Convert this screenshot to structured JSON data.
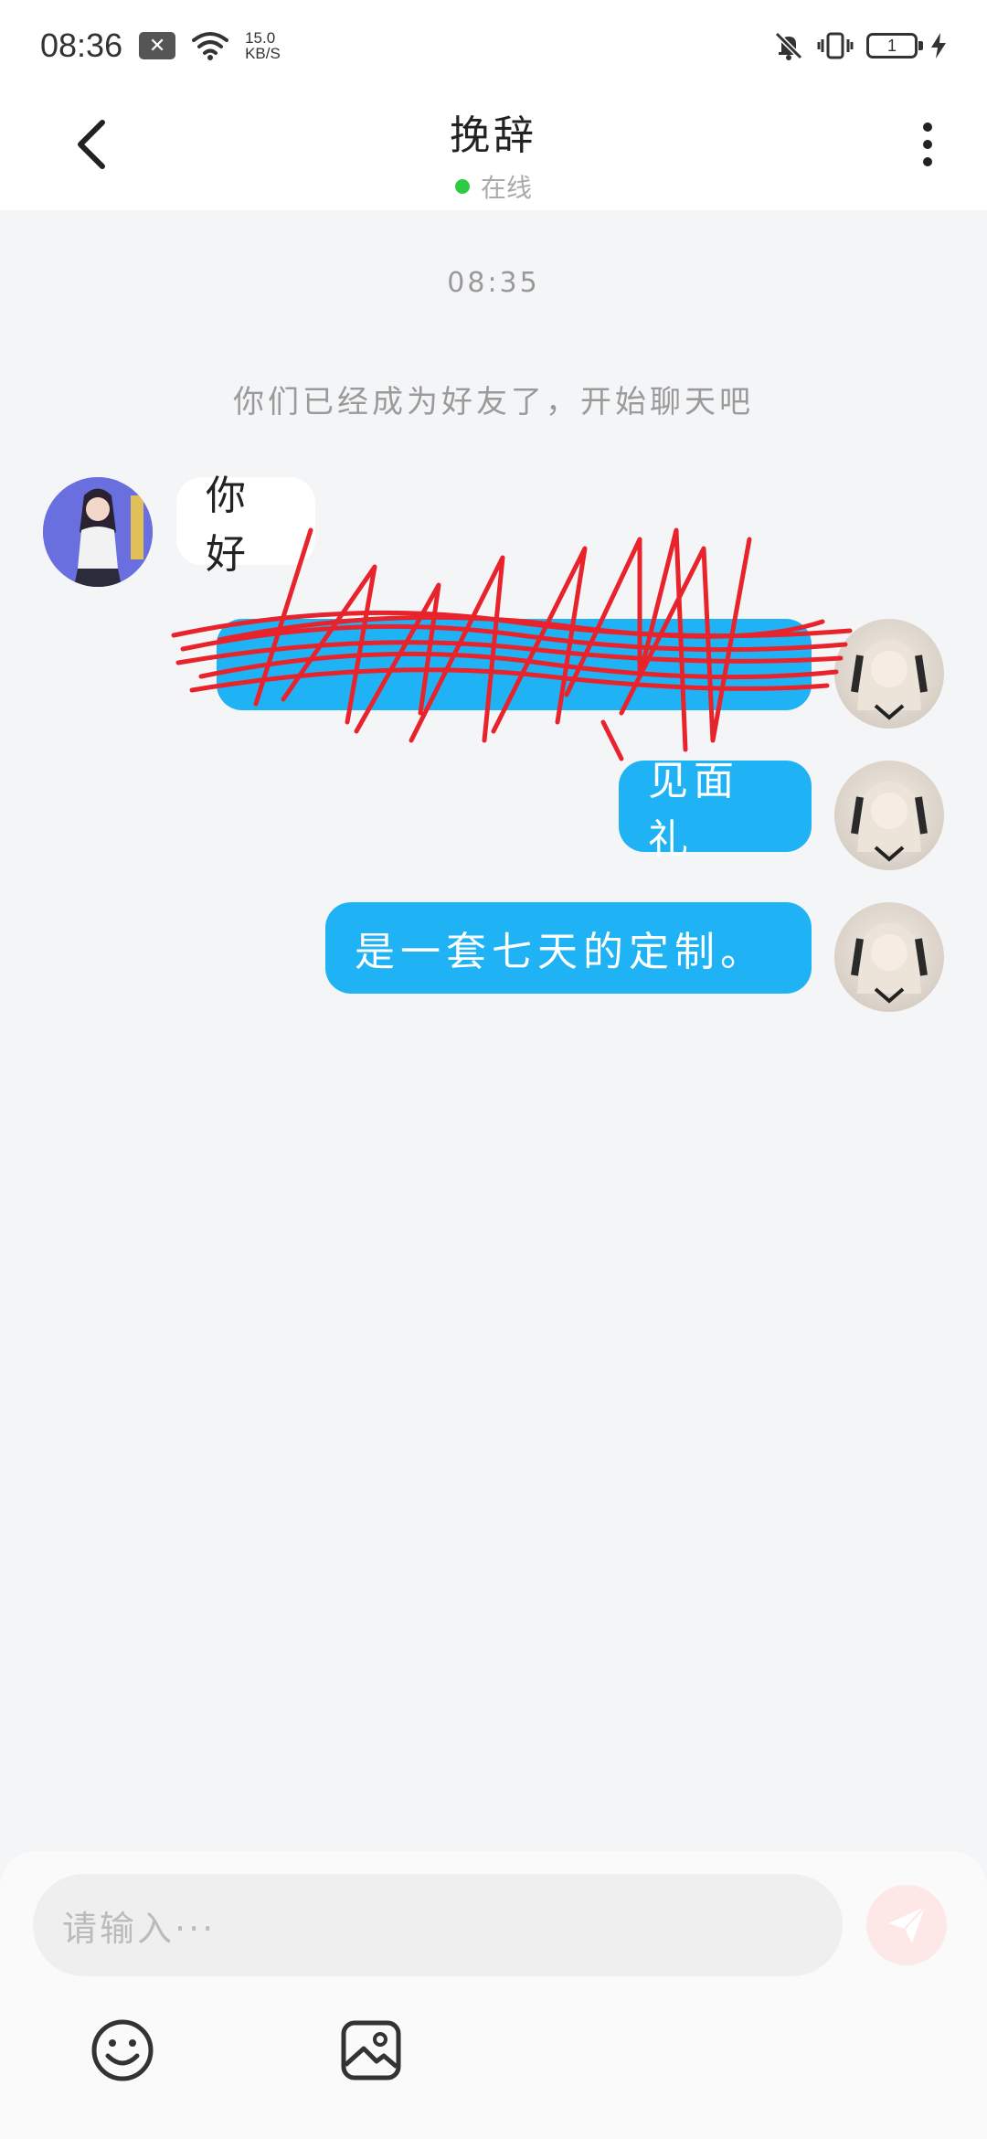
{
  "status_bar": {
    "time": "08:36",
    "net_speed_value": "15.0",
    "net_speed_unit": "KB/S",
    "battery_level": "1",
    "icons": [
      "notification-close-icon",
      "wifi-icon",
      "mute-bell-icon",
      "vibrate-icon",
      "battery-icon",
      "charging-icon"
    ]
  },
  "header": {
    "title": "挽辞",
    "status": "在线",
    "status_color": "#2ecc40"
  },
  "chat": {
    "timestamp": "08:35",
    "system_note": "你们已经成为好友了，开始聊天吧",
    "messages": [
      {
        "side": "incoming",
        "text": "你好"
      },
      {
        "side": "outgoing",
        "text": "",
        "redacted": true
      },
      {
        "side": "outgoing",
        "text": "见面礼"
      },
      {
        "side": "outgoing",
        "text": "是一套七天的定制。"
      }
    ],
    "outgoing_color": "#1fb3f5",
    "scribble_color": "#e8232b"
  },
  "composer": {
    "placeholder": "请输入···",
    "send_icon": "paper-plane-icon",
    "emoji_icon": "smiley-icon",
    "image_icon": "image-icon"
  }
}
